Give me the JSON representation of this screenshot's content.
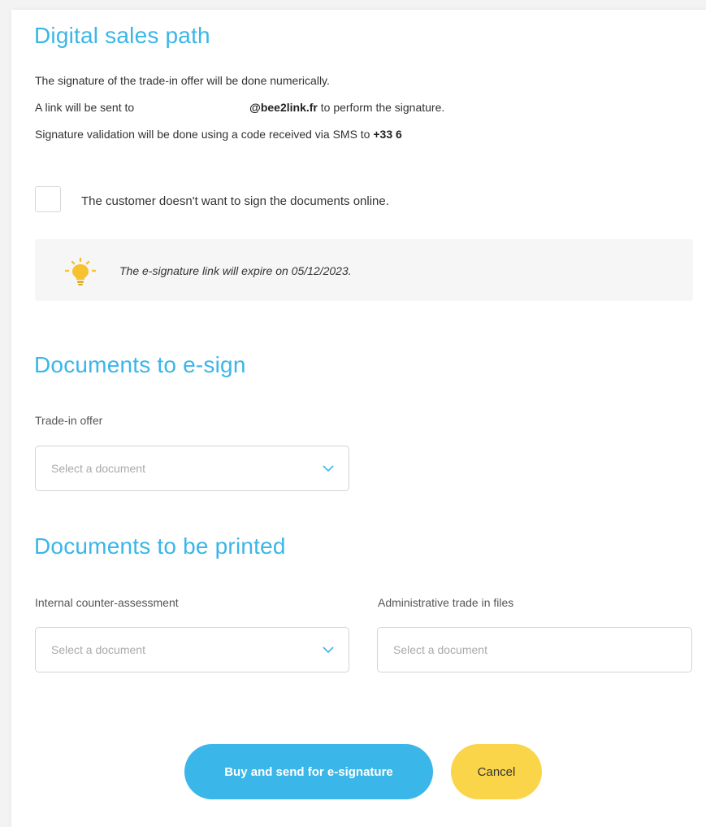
{
  "digital": {
    "title": "Digital sales path",
    "line1": "The signature of the trade-in offer will be done numerically.",
    "line2_prefix": "A link will be sent to",
    "line2_email": "@bee2link.fr",
    "line2_suffix": " to perform the signature.",
    "line3_prefix": "Signature validation will be done using a code received via SMS to ",
    "line3_phone": "+33 6",
    "checkbox_label": "The customer doesn't want to sign the documents online.",
    "checkbox_checked": false,
    "notice": "The e-signature link will expire on 05/12/2023."
  },
  "esign": {
    "title": "Documents to e-sign",
    "field_label": "Trade-in offer",
    "field_placeholder": "Select a document"
  },
  "printed": {
    "title": "Documents to be printed",
    "field1_label": "Internal counter-assessment",
    "field1_placeholder": "Select a document",
    "field2_label": "Administrative trade in files",
    "field2_placeholder": "Select a document"
  },
  "actions": {
    "primary_label": "Buy and send for e-signature",
    "cancel_label": "Cancel"
  },
  "icons": {
    "notice": "lightbulb-icon",
    "dropdown": "chevron-down-icon"
  },
  "colors": {
    "accent": "#3ab6e8",
    "cancel": "#fad54a",
    "bulb": "#f7c230"
  }
}
